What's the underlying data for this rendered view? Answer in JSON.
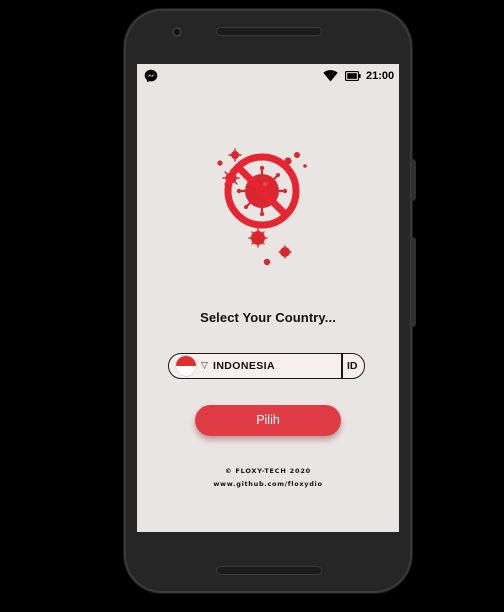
{
  "status_bar": {
    "notification_icon": "messenger-icon",
    "wifi_icon": "wifi-icon",
    "battery_icon": "battery-icon",
    "time": "21:00"
  },
  "illustration": {
    "icon": "no-virus-icon",
    "colors": {
      "virus": "#d9262f",
      "ring": "#e62530",
      "virus_light": "#f0434a"
    }
  },
  "prompt": {
    "title": "Select Your Country..."
  },
  "country_picker": {
    "flag_icon": "indonesia-flag-icon",
    "caret_icon": "dropdown-caret-icon",
    "caret_glyph": "▽",
    "selected_country": "INDONESIA",
    "code": "ID"
  },
  "actions": {
    "submit_label": "Pilih"
  },
  "footer": {
    "copyright": "© FLOXY-TECH 2020",
    "link": "www.github.com/floxydio"
  },
  "colors": {
    "screen_background": "#e9e5e3",
    "accent": "#e03c45",
    "phone_body": "#262626"
  }
}
